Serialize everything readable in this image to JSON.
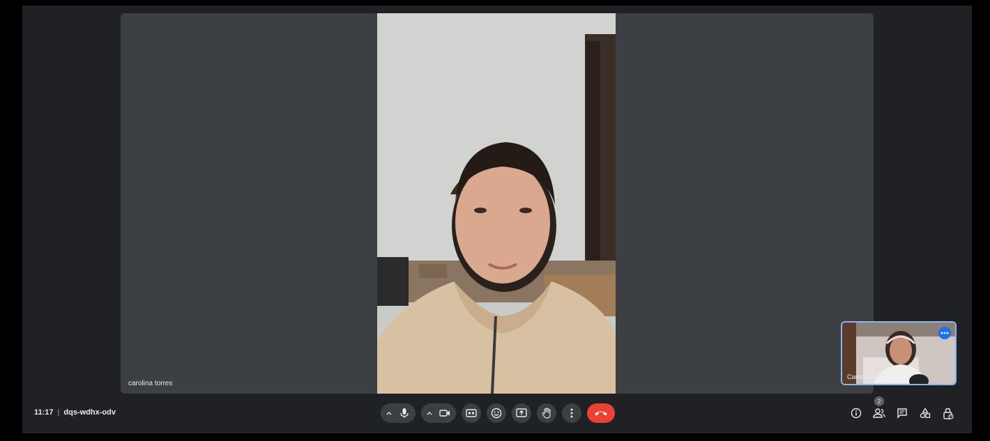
{
  "meeting": {
    "time": "11:17",
    "separator": "|",
    "code": "dqs-wdhx-odv"
  },
  "main_tile": {
    "participant_name": "carolina torres"
  },
  "self_tile": {
    "participant_name": "Camila Arana"
  },
  "people": {
    "count": "2"
  },
  "colors": {
    "background": "#202124",
    "tile": "#3c4043",
    "end_call": "#ea4335",
    "accent": "#8ab4f8"
  },
  "icons": {
    "mic": "microphone-icon",
    "camera": "video-camera-icon",
    "captions": "closed-captions-icon",
    "reactions": "emoji-icon",
    "present": "present-screen-icon",
    "raise_hand": "hand-icon",
    "more": "more-vert-icon",
    "end_call": "phone-hangup-icon",
    "info": "info-icon",
    "people": "people-icon",
    "chat": "chat-icon",
    "activities": "activities-icon",
    "host_controls": "lock-person-icon"
  }
}
